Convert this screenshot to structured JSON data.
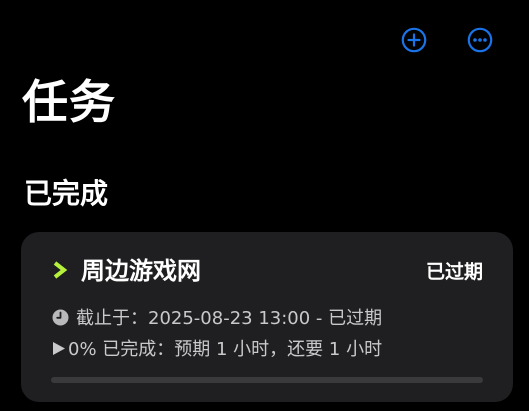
{
  "header": {
    "add_icon": "plus-circle-icon",
    "more_icon": "ellipsis-circle-icon",
    "accent_color": "#1a73e8"
  },
  "page": {
    "title": "任务"
  },
  "section": {
    "title": "已完成"
  },
  "task": {
    "title": "周边游戏网",
    "badge": "已过期",
    "deadline_text": "截止于：2025-08-23 13:00 - 已过期",
    "progress_text": "0% 已完成：预期 1 小时，还要 1 小时",
    "progress_fraction": 0,
    "chevron_color": "#b6f23c"
  }
}
